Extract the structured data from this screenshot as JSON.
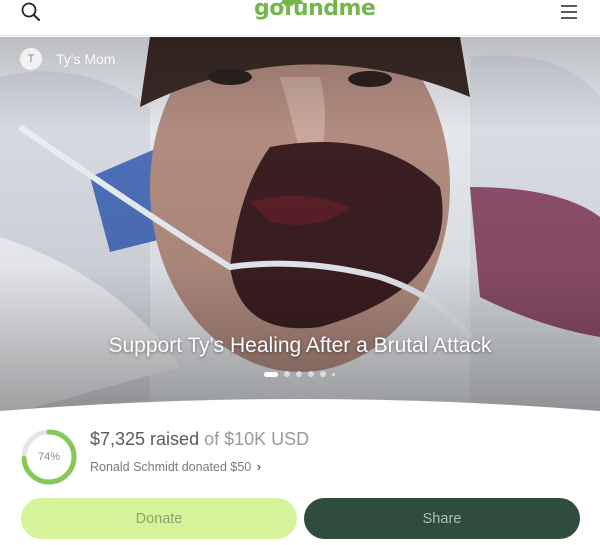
{
  "header": {
    "logo_text": "gofundme",
    "search_icon": "search-icon",
    "menu_icon": "hamburger-menu-icon",
    "brand_color": "#72b74c"
  },
  "campaign": {
    "organizer_initial": "T",
    "organizer_name": "Ty's Mom",
    "title": "Support Ty's Healing After a Brutal Attack",
    "carousel": {
      "total_slides": 6,
      "active_index": 0
    }
  },
  "stats": {
    "progress_percent_label": "74%",
    "progress_fraction": 0.74,
    "raised_amount": "$7,325 raised",
    "goal_text": "of $10K USD",
    "recent_donation": "Ronald Schmidt donated $50",
    "recent_chevron": "›"
  },
  "actions": {
    "donate_label": "Donate",
    "share_label": "Share",
    "donate_color": "#d5f39a",
    "share_color": "#304c3c"
  }
}
